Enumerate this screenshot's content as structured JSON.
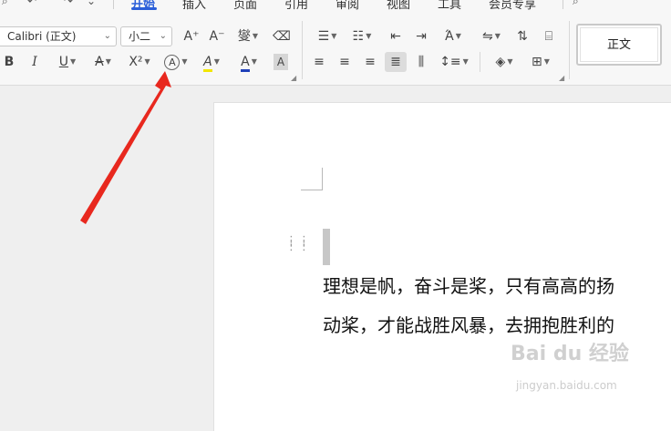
{
  "menubar": {
    "tabs": [
      "开始",
      "插入",
      "页面",
      "引用",
      "审阅",
      "视图",
      "工具",
      "会员专享"
    ],
    "active_tab": "开始",
    "search_glyph": "⌕"
  },
  "ribbon": {
    "font_name": "Calibri (正文)",
    "font_size": "小二",
    "grow_font": "A⁺",
    "shrink_font": "A⁻",
    "phonetic": "燮",
    "clear_format": "⌫",
    "bold": "B",
    "italic": "I",
    "underline": "U",
    "strikethrough": "A",
    "superscript": "X²",
    "text_effect": "A",
    "highlight": "A",
    "font_color": "A",
    "char_shading": "A",
    "highlight_color": "#f2e600",
    "font_color_value": "#1f3fb8",
    "style_normal": "正文"
  },
  "document": {
    "lines": [
      "理想是帆，奋斗是桨，只有高高的扬",
      "动桨，才能战胜风暴，去拥抱胜利的"
    ]
  },
  "watermark": {
    "text": "Bai du 经验",
    "url": "jingyan.baidu.com"
  }
}
